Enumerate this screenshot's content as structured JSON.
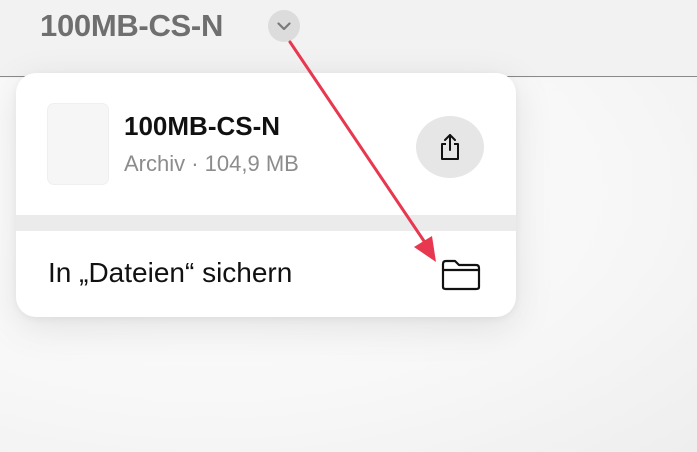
{
  "header": {
    "title": "100MB-CS-N",
    "title_menu_icon": "chevron-down-icon"
  },
  "popover": {
    "file_name": "100MB-CS-N",
    "file_meta": "Archiv · 104,9 MB",
    "share_icon": "share-icon",
    "save_to_files_label": "In „Dateien“ sichern",
    "save_icon": "folder-icon"
  },
  "annotation": {
    "arrow_color": "#e8384f"
  }
}
